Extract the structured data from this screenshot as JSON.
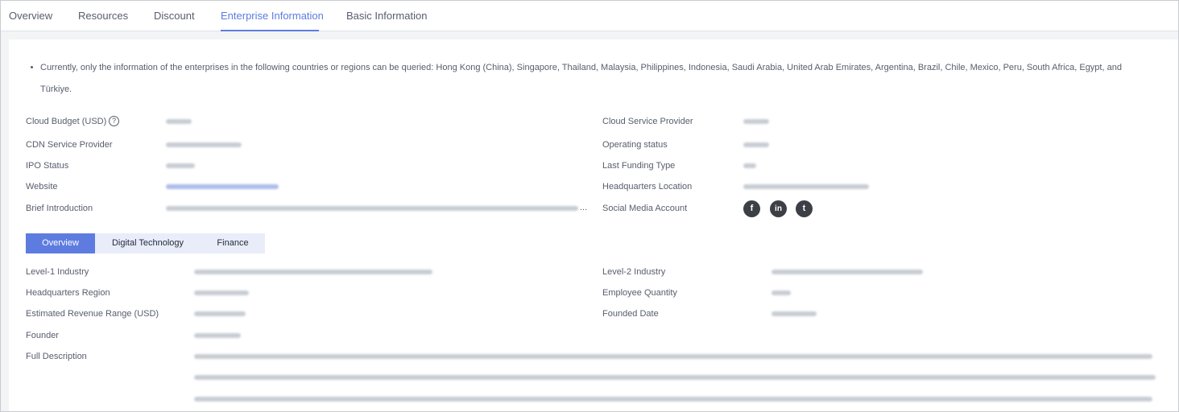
{
  "tabs": [
    {
      "label": "Overview"
    },
    {
      "label": "Resources"
    },
    {
      "label": "Discount"
    },
    {
      "label": "Enterprise Information"
    },
    {
      "label": "Basic Information"
    }
  ],
  "active_tab": "Enterprise Information",
  "notice": {
    "line1": "Currently, only the information of the enterprises in the following countries or regions can be queried: Hong Kong (China), Singapore, Thailand, Malaysia, Philippines, Indonesia, Saudi Arabia, United Arab Emirates, Argentina, Brazil, Chile, Mexico, Peru, South Africa, Egypt, and",
    "line2": "Türkiye."
  },
  "basic_fields": {
    "cloud_budget": "Cloud Budget (USD)",
    "cdn_service_provider": "CDN Service Provider",
    "ipo_status": "IPO Status",
    "website": "Website",
    "brief_introduction": "Brief Introduction",
    "cloud_service_provider": "Cloud Service Provider",
    "operating_status": "Operating status",
    "last_funding_type": "Last Funding Type",
    "headquarters_location": "Headquarters Location",
    "social_media_account": "Social Media Account"
  },
  "help_icon_glyph": "?",
  "ellipsis": "...",
  "social_icons": [
    {
      "icon": "facebook-icon",
      "glyph": "f"
    },
    {
      "icon": "linkedin-icon",
      "glyph": "in"
    },
    {
      "icon": "twitter-icon",
      "glyph": "t"
    }
  ],
  "subtabs": [
    {
      "label": "Overview"
    },
    {
      "label": "Digital Technology"
    },
    {
      "label": "Finance"
    }
  ],
  "active_subtab": "Overview",
  "overview_fields": {
    "level1_industry": "Level-1 Industry",
    "headquarters_region": "Headquarters Region",
    "estimated_revenue_range": "Estimated Revenue Range (USD)",
    "founder": "Founder",
    "full_description": "Full Description",
    "level2_industry": "Level-2 Industry",
    "employee_quantity": "Employee Quantity",
    "founded_date": "Founded Date"
  },
  "colors": {
    "accent": "#5e7ce0",
    "subtab_inactive_bg": "#e8edf9",
    "text_primary": "#252b3a",
    "text_secondary": "#575d6c",
    "background_band": "#f3f4f6"
  }
}
